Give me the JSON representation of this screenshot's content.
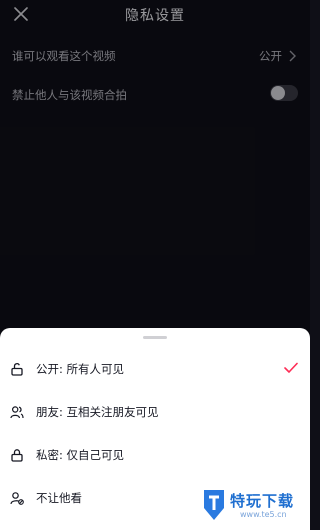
{
  "header": {
    "title": "隐私设置"
  },
  "settings": [
    {
      "label": "谁可以观看这个视频",
      "value": "公开"
    },
    {
      "label": "禁止他人与该视频合拍",
      "toggle_on": false
    }
  ],
  "sheet": {
    "options": [
      {
        "label": "公开: 所有人可见",
        "selected": true,
        "icon": "unlock-icon"
      },
      {
        "label": "朋友: 互相关注朋友可见",
        "selected": false,
        "icon": "friends-icon"
      },
      {
        "label": "私密: 仅自己可见",
        "selected": false,
        "icon": "lock-icon"
      },
      {
        "label": "不让他看",
        "selected": false,
        "icon": "block-user-icon"
      }
    ]
  },
  "watermark": {
    "name": "特玩下载",
    "url": "www.te5.cn"
  },
  "colors": {
    "accent": "#fe2c55",
    "background": "#0f0f17",
    "sheet": "#ffffff"
  }
}
